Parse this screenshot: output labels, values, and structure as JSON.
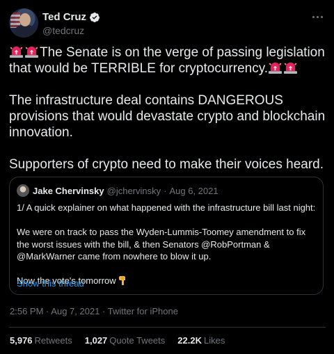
{
  "author": {
    "name": "Ted Cruz",
    "handle": "@tedcruz",
    "verified": true
  },
  "tweet": {
    "paragraphs": [
      {
        "lead_emoji": [
          "police-car-light",
          "police-car-light"
        ],
        "text": "The Senate is on the verge of passing legislation that would be TERRIBLE for cryptocurrency.",
        "trail_emoji": [
          "police-car-light",
          "police-car-light"
        ]
      },
      {
        "text": "The infrastructure deal contains DANGEROUS provisions that would devastate crypto and blockchain innovation."
      },
      {
        "text": "Supporters of crypto need to make their voices heard."
      }
    ]
  },
  "quoted_tweet": {
    "name": "Jake Chervinsky",
    "handle": "@jchervinsky",
    "separator": "·",
    "date": "Aug 6, 2021",
    "paragraphs": [
      "1/ A quick explainer on what happened with the infrastructure bill last night:",
      "We were on track to pass the Wyden-Lummis-Toomey amendment to fix the worst issues with the bill, & then Senators @RobPortman & @MarkWarner came from nowhere to blow it up.",
      "Now the vote's tomorrow"
    ],
    "trail_emoji": "backhand-index-pointing-down",
    "show_thread": "Show this thread"
  },
  "meta": {
    "time": "2:56 PM",
    "separator": "·",
    "date": "Aug 7, 2021",
    "source": "Twitter for iPhone"
  },
  "stats": {
    "retweets": {
      "value": "5,976",
      "label": "Retweets"
    },
    "quotes": {
      "value": "1,027",
      "label": "Quote Tweets"
    },
    "likes": {
      "value": "22.2K",
      "label": "Likes"
    }
  },
  "colors": {
    "background": "#000000",
    "text": "#e7e9ea",
    "secondary": "#71767b",
    "link": "#1d9bf0",
    "border": "#2f3336",
    "siren_red": "#e0245e"
  }
}
